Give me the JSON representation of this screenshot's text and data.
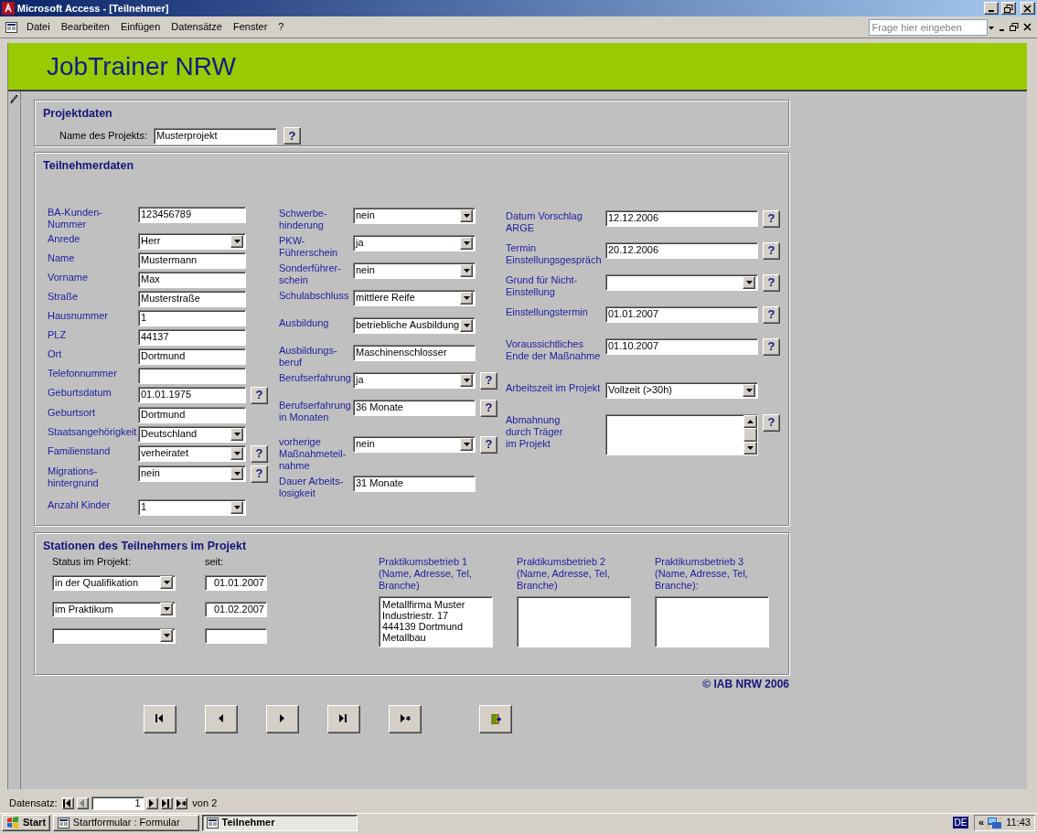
{
  "window": {
    "title": "Microsoft Access - [Teilnehmer]"
  },
  "menu": [
    {
      "label": "Datei"
    },
    {
      "label": "Bearbeiten"
    },
    {
      "label": "Einfügen"
    },
    {
      "label": "Datensätze"
    },
    {
      "label": "Fenster"
    },
    {
      "label": "?"
    }
  ],
  "help_search": {
    "placeholder": "Frage hier eingeben"
  },
  "banner": {
    "title": "JobTrainer NRW"
  },
  "projektdaten": {
    "heading": "Projektdaten",
    "field": {
      "label": "Name des Projekts:",
      "value": "Musterprojekt",
      "kind": "text",
      "help": "?"
    }
  },
  "teilnehmerdaten": {
    "heading": "Teilnehmerdaten",
    "columns": [
      {
        "fields": [
          {
            "label": "BA-Kunden-Nummer",
            "value": "123456789",
            "kind": "text"
          },
          {
            "label": "Anrede",
            "value": "Herr",
            "kind": "combo"
          },
          {
            "label": "Name",
            "value": "Mustermann",
            "kind": "text"
          },
          {
            "label": "Vorname",
            "value": "Max",
            "kind": "text"
          },
          {
            "label": "Straße",
            "value": "Musterstraße",
            "kind": "text"
          },
          {
            "label": "Hausnummer",
            "value": "1",
            "kind": "text"
          },
          {
            "label": "PLZ",
            "value": "44137",
            "kind": "text"
          },
          {
            "label": "Ort",
            "value": "Dortmund",
            "kind": "text"
          },
          {
            "label": "Telefonnummer",
            "kind": "text"
          },
          {
            "label": "Geburtsdatum",
            "value": "01.01.1975",
            "kind": "text",
            "help": "?"
          },
          {
            "label": "Geburtsort",
            "value": "Dortmund",
            "kind": "text"
          },
          {
            "label": "Staatsangehörigkeit",
            "value": "Deutschland",
            "kind": "combo"
          },
          {
            "label": "Familienstand",
            "value": "verheiratet",
            "kind": "combo",
            "help": "?"
          },
          {
            "label": "Migrations-\nhintergrund",
            "value": "nein",
            "kind": "combo",
            "help": "?"
          },
          {
            "label": "Anzahl Kinder",
            "value": "1",
            "kind": "combo"
          }
        ]
      },
      {
        "fields": [
          {
            "label": "Schwerbe-\nhinderung",
            "value": "nein",
            "kind": "combo"
          },
          {
            "label": "PKW-\nFührerschein",
            "value": "ja",
            "kind": "combo"
          },
          {
            "label": "Sonderführer-\nschein",
            "value": "nein",
            "kind": "combo"
          },
          {
            "label": "Schulabschluss",
            "value": "mittlere Reife",
            "kind": "combo"
          },
          {
            "label": "Ausbildung",
            "value": "betriebliche Ausbildung",
            "kind": "combo"
          },
          {
            "label": "Ausbildungs-\nberuf",
            "value": "Maschinenschlosser",
            "kind": "text"
          },
          {
            "label": "Berufserfahrung",
            "value": "ja",
            "kind": "combo",
            "help": "?"
          },
          {
            "label": "Berufserfahrung\nin Monaten",
            "value": "36 Monate",
            "kind": "text",
            "help": "?"
          },
          {
            "label": "vorherige\nMaßnahmeteil-\nnahme",
            "value": "nein",
            "kind": "combo",
            "help": "?"
          },
          {
            "label": "Dauer Arbeits-\nlosigkeit",
            "value": "31 Monate",
            "kind": "text"
          }
        ]
      },
      {
        "fields": [
          {
            "label": "Datum Vorschlag\nARGE",
            "value": "12.12.2006",
            "kind": "text",
            "help": "?"
          },
          {
            "label": "Termin\nEinstellungsgespräch",
            "value": "20.12.2006",
            "kind": "text",
            "help": "?"
          },
          {
            "label": "Grund für Nicht-\nEinstellung",
            "kind": "combo",
            "help": "?"
          },
          {
            "label": "Einstellungstermin",
            "value": "01.01.2007",
            "kind": "text",
            "help": "?"
          },
          {
            "label": "Voraussichtliches\nEnde der Maßnahme",
            "value": "01.10.2007",
            "kind": "text",
            "help": "?"
          },
          {
            "label": "Arbeitszeit im Projekt",
            "value": "Vollzeit (>30h)",
            "kind": "combo"
          },
          {
            "label": "Abmahnung\ndurch Träger\nim Projekt",
            "kind": "memo",
            "help": "?"
          }
        ]
      }
    ]
  },
  "stationen": {
    "heading": "Stationen des Teilnehmers im Projekt",
    "status_label": "Status im Projekt:",
    "since_label": "seit:",
    "rows": [
      {
        "status": "in der Qualifikation",
        "since": "01.01.2007"
      },
      {
        "status": "im Praktikum",
        "since": "01.02.2007"
      },
      {}
    ],
    "companies": [
      {
        "label": "Praktikumsbetrieb 1\n(Name, Adresse, Tel,\nBranche)",
        "lines": [
          "Metallfirma Muster",
          "Industriestr. 17",
          "444139 Dortmund",
          "Metallbau"
        ]
      },
      {
        "label": "Praktikumsbetrieb 2\n(Name, Adresse, Tel,\nBranche)"
      },
      {
        "label": "Praktikumsbetrieb 3\n(Name, Adresse, Tel,\nBranche):"
      }
    ]
  },
  "copyright": "© IAB NRW 2006",
  "nav_buttons": [
    {
      "kind": "first"
    },
    {
      "kind": "prev"
    },
    {
      "kind": "next"
    },
    {
      "kind": "last"
    },
    {
      "kind": "new"
    },
    {
      "kind": "exit"
    }
  ],
  "record_nav": {
    "label": "Datensatz:",
    "current": "1",
    "total": "von 2",
    "buttons": [
      {
        "kind": "first",
        "disabled": false
      },
      {
        "kind": "prev",
        "disabled": true
      },
      {
        "kind": "next",
        "disabled": false
      },
      {
        "kind": "last",
        "disabled": false
      },
      {
        "kind": "new",
        "disabled": false
      }
    ]
  },
  "taskbar": {
    "start": "Start",
    "tasks": [
      {
        "label": "Startformular : Formular",
        "selected": false
      },
      {
        "label": "Teilnehmer",
        "selected": true
      }
    ],
    "language": "DE",
    "expand": "«",
    "clock": "11:43"
  }
}
